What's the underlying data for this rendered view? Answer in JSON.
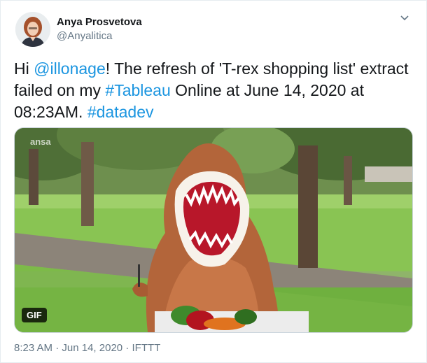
{
  "author": {
    "name": "Anya Prosvetova",
    "handle": "@Anyalitica"
  },
  "tweet": {
    "hi": "Hi ",
    "mention": "@illonage",
    "text_a": "! The refresh of 'T-rex shopping list' extract failed on my ",
    "hashtag_tableau": "#Tableau",
    "text_b": " Online at June 14, 2020 at 08:23AM. ",
    "hashtag_datadev": "#datadev"
  },
  "media": {
    "badge": "GIF",
    "watermark": "ansa"
  },
  "meta": {
    "time": "8:23 AM",
    "separator1": " · ",
    "date": "Jun 14, 2020",
    "separator2": " · ",
    "source": "IFTTT"
  },
  "colors": {
    "link": "#1b95e0",
    "text": "#14171a",
    "muted": "#657786"
  },
  "icons": {
    "caret": "chevron-down-icon"
  }
}
